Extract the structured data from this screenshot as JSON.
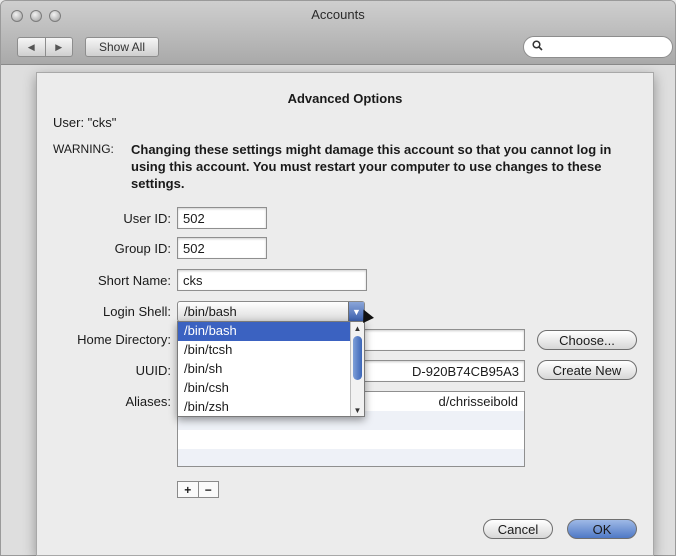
{
  "window": {
    "title": "Accounts"
  },
  "toolbar": {
    "back_glyph": "◀",
    "forward_glyph": "▶",
    "show_all_label": "Show All",
    "search_placeholder": "",
    "search_glyph": "🔍"
  },
  "sheet": {
    "title": "Advanced Options",
    "user_line": "User: \"cks\"",
    "warning_label": "WARNING:",
    "warning_text": "Changing these settings might damage this account so that you cannot log in using this account. You must restart your computer to use changes to these settings."
  },
  "form": {
    "user_id_label": "User ID:",
    "user_id_value": "502",
    "group_id_label": "Group ID:",
    "group_id_value": "502",
    "short_name_label": "Short Name:",
    "short_name_value": "cks",
    "login_shell_label": "Login Shell:",
    "login_shell_value": "/bin/bash",
    "home_dir_label": "Home Directory:",
    "home_dir_value": "",
    "uuid_label": "UUID:",
    "uuid_value_visible": "D-920B74CB95A3",
    "aliases_label": "Aliases:",
    "aliases": [
      "d/chrisseibold",
      ""
    ]
  },
  "shell_options": [
    "/bin/bash",
    "/bin/tcsh",
    "/bin/sh",
    "/bin/csh",
    "/bin/zsh"
  ],
  "buttons": {
    "choose": "Choose...",
    "create_new": "Create New",
    "cancel": "Cancel",
    "ok": "OK",
    "plus": "+",
    "minus": "−"
  },
  "colors": {
    "selection": "#3b62c1",
    "ok_button": "#5a82c9"
  }
}
